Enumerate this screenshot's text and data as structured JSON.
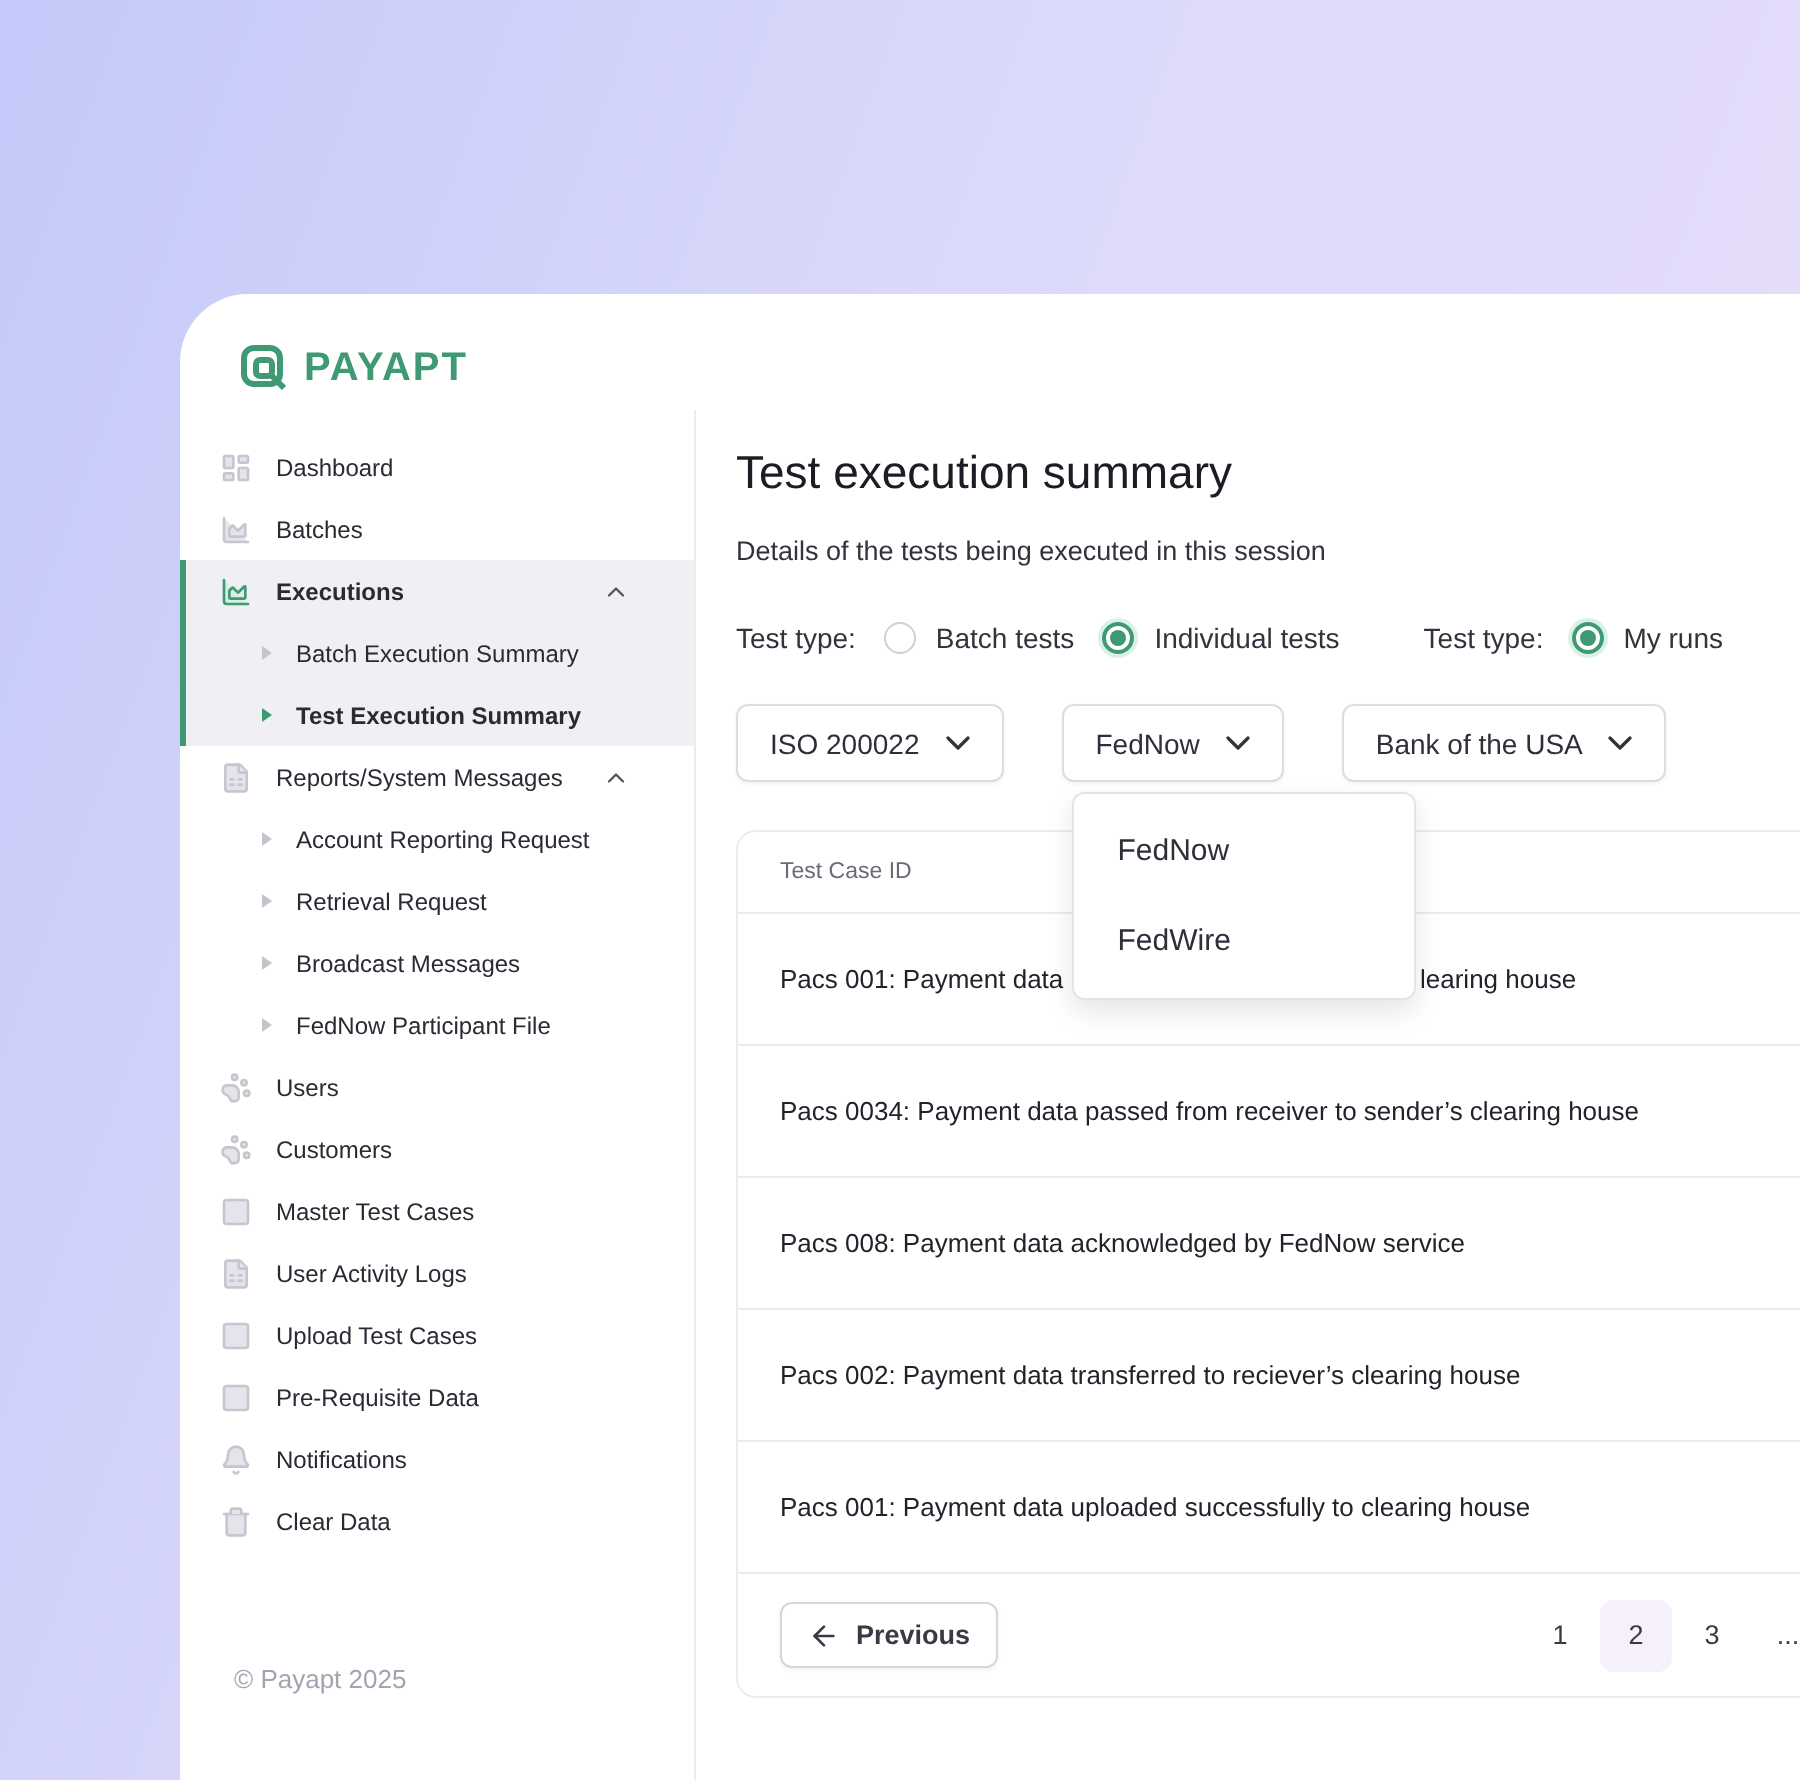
{
  "logo": {
    "text": "PAYAPT"
  },
  "sidebar": {
    "items": [
      {
        "label": "Dashboard",
        "selected": false
      },
      {
        "label": "Batches",
        "selected": false
      },
      {
        "label": "Executions",
        "selected": true,
        "expanded": true,
        "children": [
          {
            "label": "Batch Execution Summary",
            "selected": false
          },
          {
            "label": "Test Execution Summary",
            "selected": true
          }
        ]
      },
      {
        "label": "Reports/System Messages",
        "selected": false,
        "expanded": true,
        "children": [
          {
            "label": "Account Reporting Request",
            "selected": false
          },
          {
            "label": "Retrieval Request",
            "selected": false
          },
          {
            "label": "Broadcast Messages",
            "selected": false
          },
          {
            "label": "FedNow Participant File",
            "selected": false
          }
        ]
      },
      {
        "label": "Users",
        "selected": false
      },
      {
        "label": "Customers",
        "selected": false
      },
      {
        "label": "Master Test Cases",
        "selected": false
      },
      {
        "label": "User Activity Logs",
        "selected": false
      },
      {
        "label": "Upload Test Cases",
        "selected": false
      },
      {
        "label": "Pre-Requisite Data",
        "selected": false
      },
      {
        "label": "Notifications",
        "selected": false
      },
      {
        "label": "Clear Data",
        "selected": false
      }
    ],
    "footer": "© Payapt 2025"
  },
  "main": {
    "title": "Test execution summary",
    "subtitle": "Details of the tests being executed in this session",
    "filters": [
      {
        "label": "Test type:",
        "options": [
          {
            "label": "Batch tests",
            "selected": false
          },
          {
            "label": "Individual tests",
            "selected": true
          }
        ]
      },
      {
        "label": "Test type:",
        "options": [
          {
            "label": "My runs",
            "selected": true
          }
        ]
      }
    ],
    "dropdowns": [
      {
        "value": "ISO 200022"
      },
      {
        "value": "FedNow",
        "options": [
          "FedNow",
          "FedWire"
        ]
      },
      {
        "value": "Bank of the USA"
      }
    ],
    "table": {
      "columns": [
        "Test Case ID"
      ],
      "rows": [
        {
          "parts": [
            "Pacs 001: Payment data",
            "learing house"
          ]
        },
        {
          "parts": [
            "Pacs 0034: Payment data passed from receiver to sender’s clearing house"
          ]
        },
        {
          "parts": [
            "Pacs 008: Payment data acknowledged by FedNow service"
          ]
        },
        {
          "parts": [
            "Pacs 002: Payment data transferred to reciever’s clearing house"
          ]
        },
        {
          "parts": [
            "Pacs 001: Payment data uploaded successfully to clearing house"
          ]
        }
      ]
    },
    "pagination": {
      "previous": "Previous",
      "pages": [
        {
          "label": "1",
          "selected": false
        },
        {
          "label": "2",
          "selected": true
        },
        {
          "label": "3",
          "selected": false
        },
        {
          "label": "...",
          "selected": false
        }
      ]
    }
  }
}
